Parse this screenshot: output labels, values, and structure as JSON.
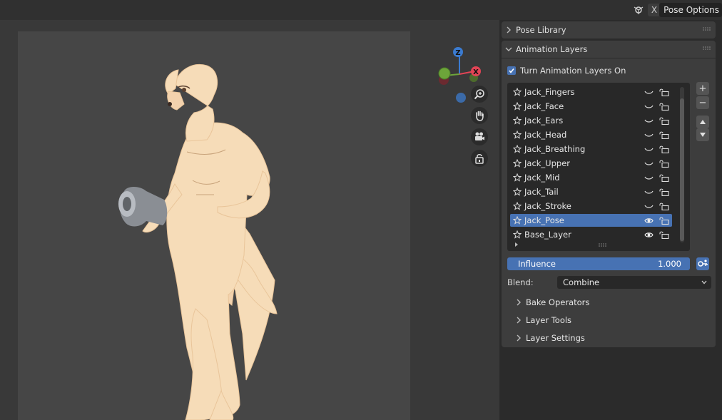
{
  "header": {
    "close_label": "X",
    "pose_options_label": "Pose Options"
  },
  "panels": {
    "pose_library": {
      "title": "Pose Library"
    },
    "animation_layers": {
      "title": "Animation Layers",
      "toggle_label": "Turn Animation Layers On",
      "toggle_checked": true,
      "layers": [
        {
          "name": "Jack_Fingers",
          "visible": false,
          "selected": false
        },
        {
          "name": "Jack_Face",
          "visible": false,
          "selected": false
        },
        {
          "name": "Jack_Ears",
          "visible": false,
          "selected": false
        },
        {
          "name": "Jack_Head",
          "visible": false,
          "selected": false
        },
        {
          "name": "Jack_Breathing",
          "visible": false,
          "selected": false
        },
        {
          "name": "Jack_Upper",
          "visible": false,
          "selected": false
        },
        {
          "name": "Jack_Mid",
          "visible": false,
          "selected": false
        },
        {
          "name": "Jack_Tail",
          "visible": false,
          "selected": false
        },
        {
          "name": "Jack_Stroke",
          "visible": false,
          "selected": false
        },
        {
          "name": "Jack_Pose",
          "visible": true,
          "selected": true
        },
        {
          "name": "Base_Layer",
          "visible": true,
          "selected": false
        }
      ],
      "influence_label": "Influence",
      "influence_value": "1.000",
      "blend_label": "Blend:",
      "blend_value": "Combine",
      "subpanels": [
        "Bake Operators",
        "Layer Tools",
        "Layer Settings"
      ]
    }
  },
  "gizmo": {
    "z_label": "Z",
    "x_label": "X"
  },
  "colors": {
    "accent": "#4772b3",
    "axis_x": "#e24455",
    "axis_y": "#6da53a",
    "axis_z": "#3b7bd0",
    "skin": "#f6dcb8"
  },
  "icons": [
    "blender-icon",
    "zoom-icon",
    "hand-icon",
    "camera-icon",
    "lock-icon",
    "star-icon",
    "eye-icon",
    "eye-closed-icon",
    "key-icon"
  ]
}
